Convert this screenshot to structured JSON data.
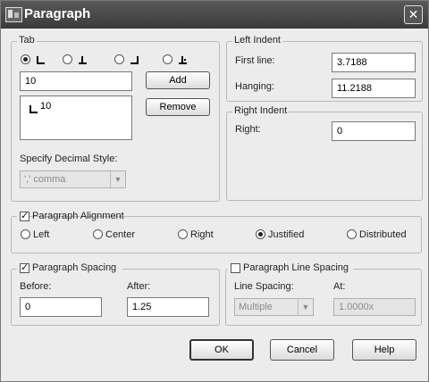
{
  "window": {
    "title": "Paragraph",
    "close_glyph": "✕"
  },
  "tab": {
    "legend": "Tab",
    "tab_types": [
      {
        "icon": "left-tab-icon",
        "selected": true
      },
      {
        "icon": "center-tab-icon",
        "selected": false
      },
      {
        "icon": "right-tab-icon",
        "selected": false
      },
      {
        "icon": "decimal-tab-icon",
        "selected": false
      }
    ],
    "position_value": "10",
    "add_label": "Add",
    "remove_label": "Remove",
    "stops": [
      {
        "icon": "left-tab-icon",
        "value": "10"
      }
    ],
    "decimal_style_label": "Specify Decimal Style:",
    "decimal_style_value": "',' comma"
  },
  "left_indent": {
    "legend": "Left Indent",
    "first_line_label": "First line:",
    "first_line_value": "3.7188",
    "hanging_label": "Hanging:",
    "hanging_value": "11.2188"
  },
  "right_indent": {
    "legend": "Right Indent",
    "right_label": "Right:",
    "right_value": "0"
  },
  "alignment": {
    "legend": "Paragraph Alignment",
    "checked": true,
    "options": [
      {
        "label": "Left",
        "selected": false
      },
      {
        "label": "Center",
        "selected": false
      },
      {
        "label": "Right",
        "selected": false
      },
      {
        "label": "Justified",
        "selected": true
      },
      {
        "label": "Distributed",
        "selected": false
      }
    ]
  },
  "spacing": {
    "legend": "Paragraph Spacing",
    "checked": true,
    "before_label": "Before:",
    "before_value": "0",
    "after_label": "After:",
    "after_value": "1.25"
  },
  "line_spacing": {
    "legend": "Paragraph Line Spacing",
    "checked": false,
    "line_spacing_label": "Line Spacing:",
    "line_spacing_value": "Multiple",
    "at_label": "At:",
    "at_value": "1.0000x"
  },
  "buttons": {
    "ok": "OK",
    "cancel": "Cancel",
    "help": "Help"
  },
  "colors": {
    "titlebar": "#4a4a4a",
    "background": "#ececec"
  }
}
